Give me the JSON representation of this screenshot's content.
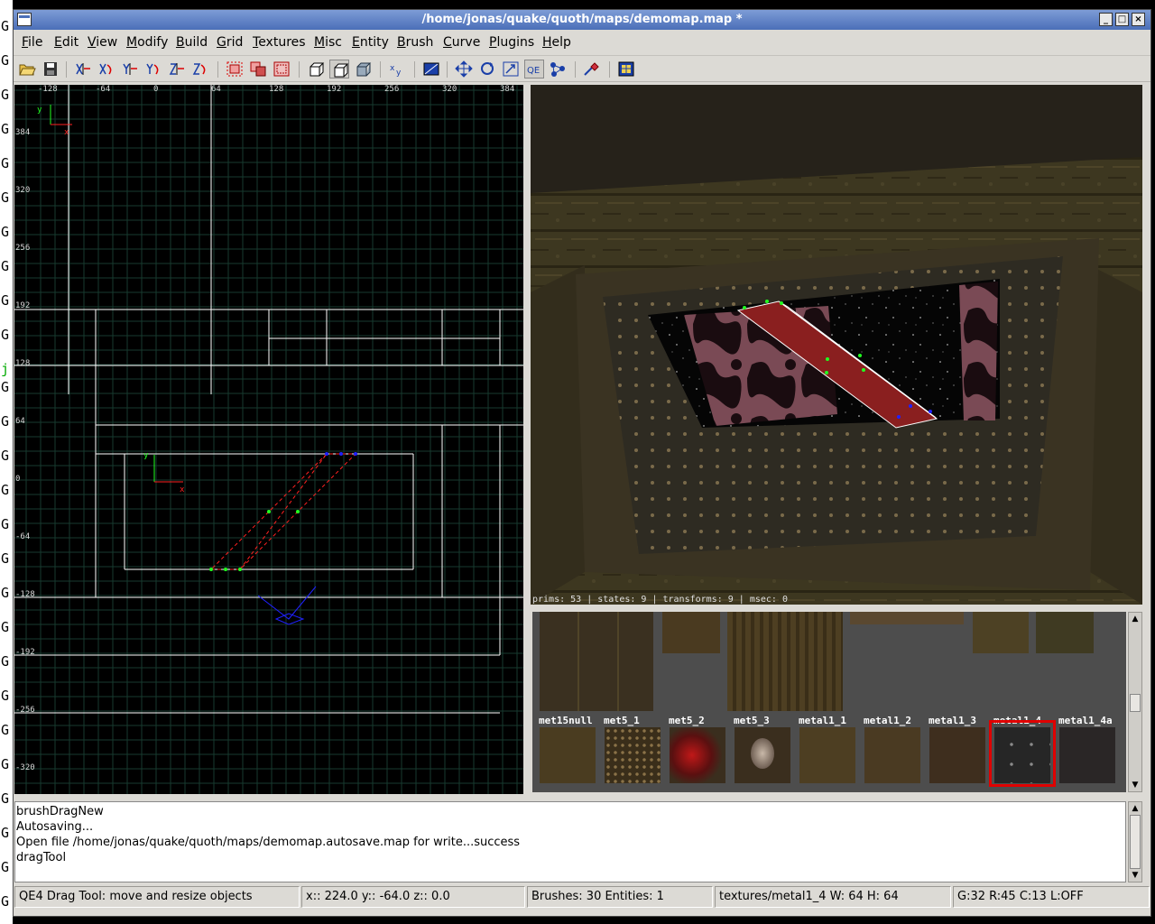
{
  "desktop": {
    "strip_glyph": "G",
    "active_glyph": "j"
  },
  "window": {
    "title": "/home/jonas/quake/quoth/maps/demomap.map *",
    "controls": [
      "_",
      "□",
      "×"
    ]
  },
  "menu": [
    "File",
    "Edit",
    "View",
    "Modify",
    "Build",
    "Grid",
    "Textures",
    "Misc",
    "Entity",
    "Brush",
    "Curve",
    "Plugins",
    "Help"
  ],
  "toolbar": {
    "buttons": [
      "open-file-icon",
      "save-file-icon",
      "flip-x-icon",
      "rotate-x-icon",
      "flip-y-icon",
      "rotate-y-icon",
      "flip-z-icon",
      "rotate-z-icon",
      "select-complete-icon",
      "select-touching-icon",
      "select-inside-icon",
      "cube-view-icon",
      "cube-view-pressed-icon",
      "texture-lock-icon",
      "change-view-icon",
      "show-clip-icon",
      "drag-tool-icon",
      "rotate-tool-icon",
      "scale-tool-icon",
      "qe-tool-icon",
      "plugin-icon",
      "camera-icon",
      "patch-icon",
      "texture-window-icon"
    ],
    "qe_label": "QE"
  },
  "view2d": {
    "x_ticks": [
      "-128",
      "-64",
      "0",
      "64",
      "128",
      "192",
      "256",
      "320",
      "384"
    ],
    "y_ticks": [
      "384",
      "320",
      "256",
      "192",
      "128",
      "64",
      "0",
      "-64",
      "-128",
      "-192",
      "-256",
      "-320"
    ],
    "axis_x_label": "x",
    "axis_y_label": "y"
  },
  "camera": {
    "stats": "prims: 53 | states: 9 | transforms: 9 | msec: 0"
  },
  "textures": {
    "names": [
      "met15null",
      "met5_1",
      "met5_2",
      "met5_3",
      "metal1_1",
      "metal1_2",
      "metal1_3",
      "metal1_4",
      "metal1_4a"
    ],
    "selected": "metal1_4"
  },
  "console": {
    "lines": [
      "brushDragNew",
      "Autosaving...",
      "Open file /home/jonas/quake/quoth/maps/demomap.autosave.map for write...success",
      "dragTool"
    ]
  },
  "status": {
    "tool": "QE4 Drag Tool: move and resize objects",
    "coords": "x::  224.0  y::  -64.0  z::    0.0",
    "counts": "Brushes: 30 Entities: 1",
    "texture": "textures/metal1_4 W: 64 H: 64",
    "grid": "G:32  R:45  C:13  L:OFF"
  },
  "colors": {
    "grid_minor": "#173a2f",
    "grid_major": "#ffffff",
    "selection": "#ff2020",
    "selected_texture_border": "#e00000",
    "camera_outline": "#2020ff"
  }
}
